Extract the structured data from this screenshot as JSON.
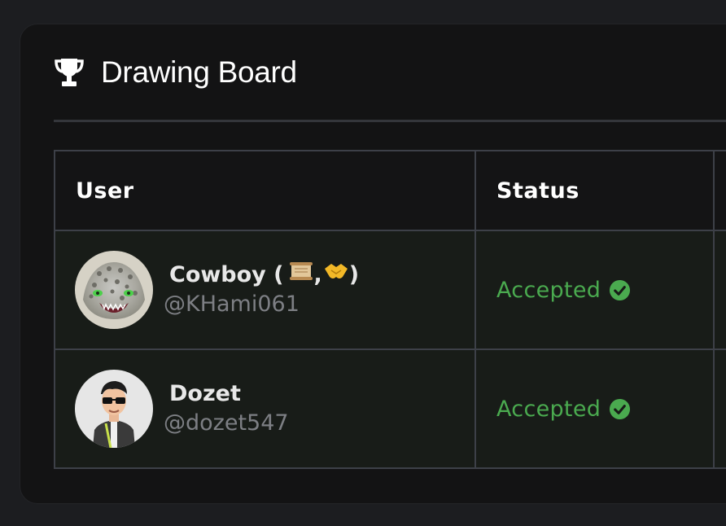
{
  "board": {
    "title": "Drawing Board",
    "icon": "trophy-icon"
  },
  "table": {
    "headers": {
      "user": "User",
      "status": "Status"
    },
    "rows": [
      {
        "display_name": "Cowboy (",
        "name_suffix": ")",
        "name_emojis": [
          "scroll-icon",
          "handshake-icon"
        ],
        "handle": "@KHami061",
        "status": "Accepted",
        "status_icon": "check-circle-icon",
        "avatar": "lizard-avatar"
      },
      {
        "display_name": "Dozet",
        "handle": "@dozet547",
        "status": "Accepted",
        "status_icon": "check-circle-icon",
        "avatar": "person-sunglasses-avatar"
      }
    ]
  },
  "colors": {
    "background": "#1c1d20",
    "card": "#131314",
    "accepted": "#4aaa4f",
    "row_bg": "#181c18",
    "border": "#3d4048"
  }
}
